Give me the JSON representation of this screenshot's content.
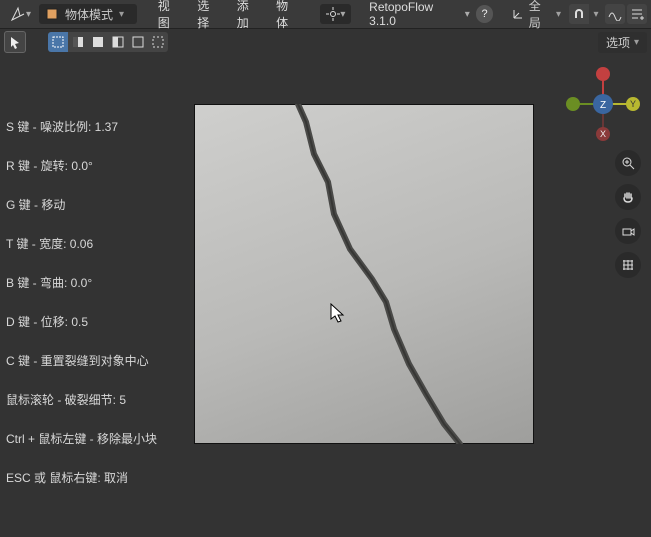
{
  "header": {
    "mode_label": "物体模式",
    "menus": {
      "view": "视图",
      "select": "选择",
      "add": "添加",
      "object": "物体"
    },
    "retopo": "RetopoFlow 3.1.0",
    "help": "?",
    "orientation": "全局",
    "options_label": "选项"
  },
  "overlay": {
    "l1": "S 键 - 噪波比例:  1.37",
    "l2": "R 键 - 旋转:  0.0°",
    "l3": "G 键 - 移动",
    "l4": "T 键 - 宽度:  0.06",
    "l5": "B 键 - 弯曲:  0.0°",
    "l6": "D 键 - 位移:  0.5",
    "l7": "C 键 - 重置裂缝到对象中心",
    "l8": "鼠标滚轮 - 破裂细节:  5",
    "l9": "Ctrl + 鼠标左键 - 移除最小块",
    "l10": "ESC 或 鼠标右键: 取消"
  },
  "gizmo": {
    "x": "X",
    "y": "Y",
    "z": "Z"
  }
}
